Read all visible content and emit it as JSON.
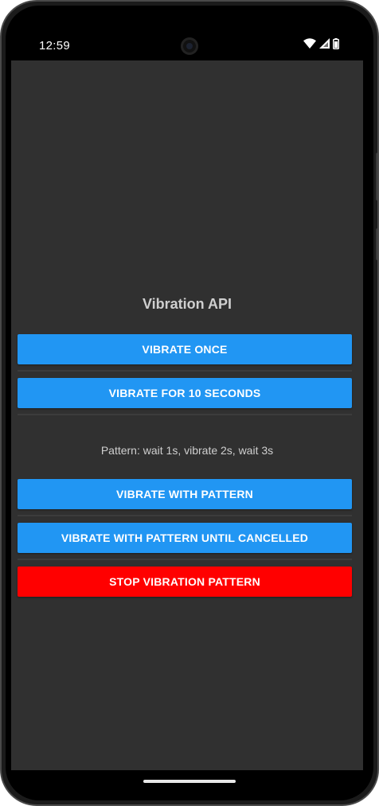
{
  "status_bar": {
    "time": "12:59",
    "icons": [
      "wifi-icon",
      "cell-signal-icon",
      "battery-icon"
    ]
  },
  "app": {
    "title": "Vibration API",
    "pattern_description": "Pattern: wait 1s, vibrate 2s, wait 3s"
  },
  "buttons": {
    "vibrate_once": "VIBRATE ONCE",
    "vibrate_10s": "VIBRATE FOR 10 SECONDS",
    "vibrate_pattern": "VIBRATE WITH PATTERN",
    "vibrate_pattern_until_cancelled": "VIBRATE WITH PATTERN UNTIL CANCELLED",
    "stop_pattern": "STOP VIBRATION PATTERN"
  },
  "colors": {
    "primary": "#2196f3",
    "stop": "#ff0000",
    "background": "#303030",
    "text": "#cfcfcf"
  }
}
